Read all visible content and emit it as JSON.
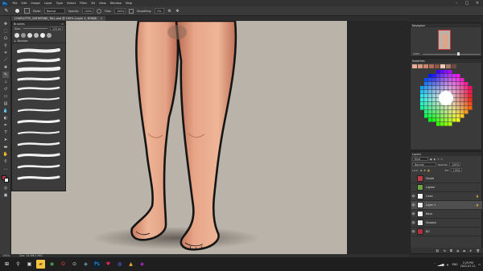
{
  "menubar": {
    "logo": "Ps",
    "items": [
      "File",
      "Edit",
      "Image",
      "Layer",
      "Type",
      "Select",
      "Filter",
      "3D",
      "View",
      "Window",
      "Help"
    ],
    "controls": [
      "–",
      "□",
      "✕"
    ]
  },
  "options": {
    "mode_label": "Mode:",
    "mode_value": "Normal",
    "opacity_label": "Opacity:",
    "opacity_value": "100%",
    "flow_label": "Flow:",
    "flow_value": "100%",
    "smoothing_label": "Smoothing:",
    "smoothing_value": "0%"
  },
  "document": {
    "tab_title": "CHARLOTTE_GATHERINE_TALL.psd @ 100% (Layer 1, RGB/8)"
  },
  "brushes": {
    "title": "Brushes",
    "size_label": "Size:",
    "size_value": "125 px",
    "group_name": "Brushes"
  },
  "navigator": {
    "title": "Navigator",
    "zoom": "100%"
  },
  "swatches": {
    "title": "Swatches"
  },
  "layers": {
    "title": "Layers",
    "search_placeholder": "Kind",
    "blend_mode": "Normal",
    "opacity_label": "Opacity:",
    "opacity_value": "100%",
    "lock_label": "Lock:",
    "fill_label": "Fill:",
    "fill_value": "100%",
    "rows": [
      {
        "name": "Shade",
        "color": "#c23a46"
      },
      {
        "name": "Lighter",
        "color": "#6aa644"
      },
      {
        "name": "Lines",
        "color": "#f2f2f2"
      },
      {
        "name": "Layer 1",
        "color": "#f0f0f0"
      },
      {
        "name": "Base",
        "color": "#f5f5f5"
      },
      {
        "name": "Shadow",
        "color": "#ececec"
      },
      {
        "name": "BG",
        "color": "#b03040"
      }
    ]
  },
  "status": {
    "zoom": "100%",
    "doc": "Doc: 24.9M/1.99G"
  },
  "taskbar": {
    "time": "2:29 PM",
    "date": "2022-07-11",
    "lang": "ENG"
  },
  "colors": {
    "canvas_bg": "#bab3a9",
    "skin_light": "#e9a888",
    "skin_mid": "#d88e73",
    "skin_dark": "#b66851",
    "foreground_swatch": "#c23a46",
    "background_swatch": "#ffffff"
  }
}
